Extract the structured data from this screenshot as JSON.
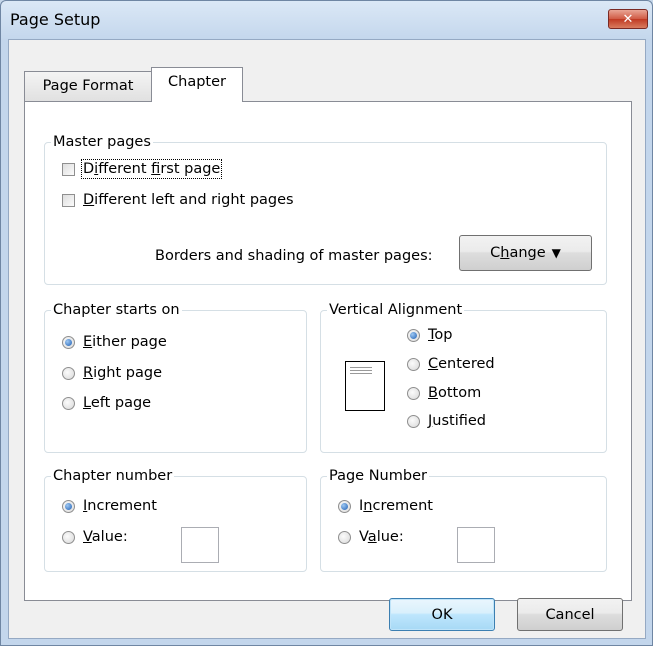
{
  "window": {
    "title": "Page Setup",
    "close_icon": "close-icon"
  },
  "tabs": [
    {
      "label": "Page Format",
      "active": false
    },
    {
      "label": "Chapter",
      "active": true
    }
  ],
  "master_pages": {
    "legend": "Master pages",
    "different_first_page": {
      "pre": "D",
      "ul": "i",
      "post": "fferent ",
      "ul2": "f",
      "post2": "irst page",
      "checked": false
    },
    "different_left_right": {
      "ul": "D",
      "post": "ifferent left and right pages",
      "checked": false
    },
    "borders_label": "Borders and shading of master pages:",
    "change_button": {
      "pre": "C",
      "ul": "h",
      "post": "ange",
      "arrow": "▼"
    }
  },
  "chapter_starts_on": {
    "legend": "Chapter starts on",
    "options": [
      {
        "ul": "E",
        "post": "ither page",
        "selected": true
      },
      {
        "ul": "R",
        "post": "ight page",
        "selected": false
      },
      {
        "ul": "L",
        "post": "eft page",
        "selected": false
      }
    ]
  },
  "vertical_alignment": {
    "legend": "Vertical Alignment",
    "options": [
      {
        "ul": "T",
        "post": "op",
        "selected": true
      },
      {
        "ul": "C",
        "post": "entered",
        "selected": false
      },
      {
        "ul": "B",
        "post": "ottom",
        "selected": false
      },
      {
        "ul": "J",
        "post": "ustified",
        "selected": false
      }
    ]
  },
  "chapter_number": {
    "legend": "Chapter number",
    "increment": {
      "ul": "I",
      "post": "ncrement",
      "selected": true
    },
    "value": {
      "ul": "V",
      "post": "alue:",
      "selected": false
    },
    "value_input": ""
  },
  "page_number": {
    "legend": "Page Number",
    "increment": {
      "pre": "I",
      "ul": "n",
      "post": "crement",
      "selected": true
    },
    "value": {
      "pre": "V",
      "ul": "a",
      "post": "lue:",
      "selected": false
    },
    "value_input": ""
  },
  "buttons": {
    "ok": "OK",
    "cancel": "Cancel"
  },
  "colors": {
    "accent": "#3c7fb1",
    "close": "#c03a23"
  }
}
